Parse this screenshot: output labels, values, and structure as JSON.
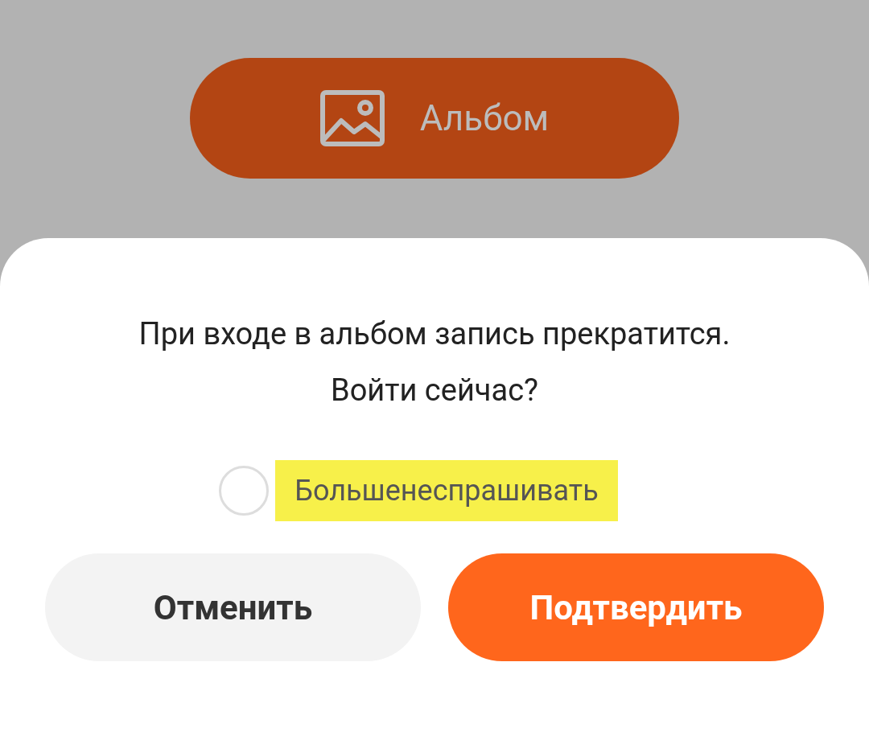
{
  "background_button": {
    "label": "Альбом"
  },
  "dialog": {
    "message_lines": [
      "При входе в альбом запись прекратится.",
      "Войти сейчас?"
    ],
    "option": {
      "label": "Большенеспрашивать",
      "checked": false,
      "highlighted": true
    },
    "buttons": [
      {
        "label": "Отменить",
        "kind": "secondary"
      },
      {
        "label": "Подтвердить",
        "kind": "primary"
      }
    ]
  }
}
